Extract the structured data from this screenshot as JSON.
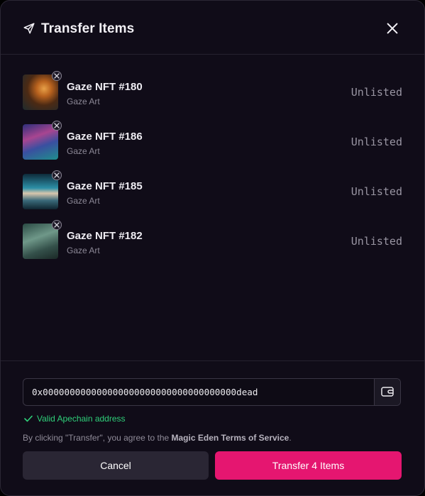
{
  "header": {
    "title": "Transfer Items",
    "icon": "send-icon",
    "close_icon": "close-icon"
  },
  "items": [
    {
      "name": "Gaze NFT #180",
      "collection": "Gaze Art",
      "status": "Unlisted",
      "thumb_colors": [
        "#4a2a12",
        "#c77a2a",
        "#1c2f33"
      ]
    },
    {
      "name": "Gaze NFT #186",
      "collection": "Gaze Art",
      "status": "Unlisted",
      "thumb_colors": [
        "#2a2f6a",
        "#b04a8c",
        "#26a0a0"
      ]
    },
    {
      "name": "Gaze NFT #185",
      "collection": "Gaze Art",
      "status": "Unlisted",
      "thumb_colors": [
        "#0f2d3a",
        "#3fb0b8",
        "#d6c2a8"
      ]
    },
    {
      "name": "Gaze NFT #182",
      "collection": "Gaze Art",
      "status": "Unlisted",
      "thumb_colors": [
        "#1d3430",
        "#5f8a7c",
        "#2b3c3a"
      ]
    }
  ],
  "address": {
    "value": "0x000000000000000000000000000000000000dead",
    "wallet_icon": "wallet-icon"
  },
  "validation": {
    "text": "Valid Apechain address",
    "color": "#2fd07a"
  },
  "terms": {
    "prefix": "By clicking \"Transfer\", you agree to the ",
    "link": "Magic Eden Terms of Service",
    "suffix": "."
  },
  "buttons": {
    "cancel": "Cancel",
    "transfer": "Transfer 4 Items"
  },
  "colors": {
    "accent": "#e51670",
    "background": "#100c18"
  }
}
